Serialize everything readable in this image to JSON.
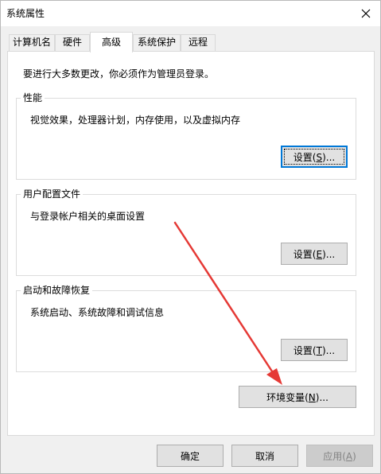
{
  "window": {
    "title": "系统属性"
  },
  "tabs": [
    {
      "label": "计算机名"
    },
    {
      "label": "硬件"
    },
    {
      "label": "高级",
      "active": true
    },
    {
      "label": "系统保护"
    },
    {
      "label": "远程"
    }
  ],
  "advanced": {
    "notice": "要进行大多数更改，你必须作为管理员登录。",
    "performance": {
      "title": "性能",
      "description": "视觉效果，处理器计划，内存使用，以及虚拟内存",
      "settings_button": {
        "label": "设置(",
        "accel": "S",
        "suffix": ")..."
      }
    },
    "user_profiles": {
      "title": "用户配置文件",
      "description": "与登录帐户相关的桌面设置",
      "settings_button": {
        "label": "设置(",
        "accel": "E",
        "suffix": ")..."
      }
    },
    "startup_recovery": {
      "title": "启动和故障恢复",
      "description": "系统启动、系统故障和调试信息",
      "settings_button": {
        "label": "设置(",
        "accel": "T",
        "suffix": ")..."
      }
    },
    "env_button": {
      "label": "环境变量(",
      "accel": "N",
      "suffix": ")..."
    }
  },
  "footer": {
    "ok_label": "确定",
    "cancel_label": "取消",
    "apply_button": {
      "label": "应用(",
      "accel": "A",
      "suffix": ")",
      "disabled": true
    }
  },
  "colors": {
    "annotation_arrow": "#e53935",
    "focus_border": "#0078d7"
  }
}
